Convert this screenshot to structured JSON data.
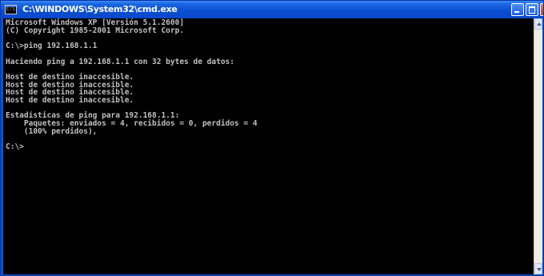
{
  "window": {
    "title": "C:\\WINDOWS\\System32\\cmd.exe",
    "icon": "console-window-icon",
    "icon_glyph": "C:\\",
    "close_glyph": "×"
  },
  "colors": {
    "titlebar": "#0a4fd4",
    "console_background": "#000000",
    "console_text": "#c0c0c0",
    "close_button": "#c2401f"
  },
  "console": {
    "lines": [
      "Microsoft Windows XP [Versión 5.1.2600]",
      "(C) Copyright 1985-2001 Microsoft Corp.",
      "",
      "C:\\>ping 192.168.1.1",
      "",
      "Haciendo ping a 192.168.1.1 con 32 bytes de datos:",
      "",
      "Host de destino inaccesible.",
      "Host de destino inaccesible.",
      "Host de destino inaccesible.",
      "Host de destino inaccesible.",
      "",
      "Estadísticas de ping para 192.168.1.1:",
      "    Paquetes: enviados = 4, recibidos = 0, perdidos = 4",
      "    (100% perdidos),",
      "",
      "C:\\>"
    ]
  },
  "controls": {
    "minimize": "minimize-icon",
    "maximize": "maximize-icon",
    "close": "close-icon"
  }
}
